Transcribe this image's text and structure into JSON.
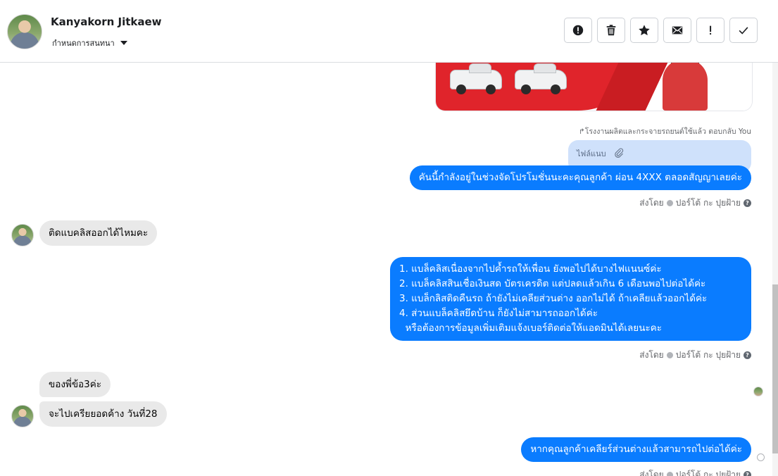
{
  "header": {
    "contact_name": "Kanyakorn Jitkaew",
    "assign_label": "กำหนดการสนทนา",
    "toolbar": [
      {
        "name": "spam-button",
        "icon": "alert-circle-icon"
      },
      {
        "name": "delete-button",
        "icon": "trash-icon"
      },
      {
        "name": "star-button",
        "icon": "star-icon"
      },
      {
        "name": "mark-unread-button",
        "icon": "envelope-icon"
      },
      {
        "name": "follow-up-button",
        "icon": "exclamation-icon"
      },
      {
        "name": "done-button",
        "icon": "check-icon"
      }
    ]
  },
  "messages": {
    "reply_note": "โรงงานผลิตและกระจายรถยนต์ใช้แล้ว ตอบกลับ You",
    "attachment_label": "ไฟล์แนบ",
    "msg1": "คันนี้กำลังอยู่ในช่วงจัดโปรโมชั่นนะคะคุณลูกค้า ผ่อน 4XXX ตลอดสัญญาเลยค่ะ",
    "sent_by_label": "ส่งโดย",
    "sender_name": "ปอร์โต้ กะ ปุยฝ้าย",
    "in1": "ติดแบคลิสออกได้ไหมคะ",
    "list_lines": [
      "1. แบล็คลิสเนื่องจากไปค้ำรถให้เพื่อน ยังพอไปได้บางไฟแนนซ์ค่ะ",
      "2. แบล็คลิสสินเชื่อเงินสด บัตรเครดิต แต่ปลดแล้วเกิน 6 เดือนพอไปต่อได้ค่ะ",
      "3. แบล็กลิสติดคืนรถ ถ้ายังไม่เคลียส่วนต่าง ออกไม่ได้ ถ้าเคลียแล้วออกได้ค่ะ",
      "4. ส่วนแบล็คลิสยึดบ้าน ก็ยังไม่สามารถออกได้ค่ะ",
      "  หรือต้องการข้อมูลเพิ่มเติมแจ้งเบอร์ติดต่อให้แอดมินได้เลยนะคะ"
    ],
    "in2": "ของพี่ข้อ3ค่ะ",
    "in3": "จะไปเครียยอดค้าง วันที่28",
    "msg_last": "หากคุณลูกค้าเคลียร์ส่วนต่างแล้วสามารถไปต่อได้ค่ะ"
  },
  "colors": {
    "outgoing_bubble": "#0a7cff",
    "incoming_bubble": "#e9e9e9",
    "attachment_bubble": "#cfe1fb"
  }
}
